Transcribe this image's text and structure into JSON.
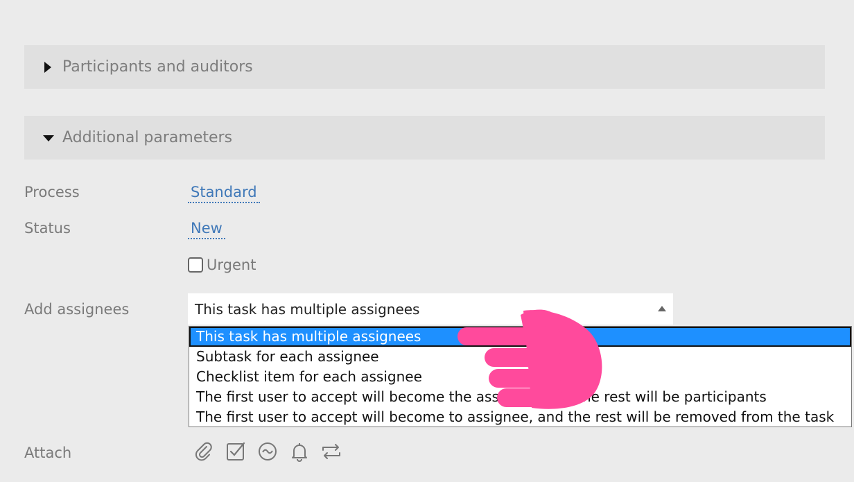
{
  "sections": {
    "participants": {
      "label": "Participants and auditors",
      "expanded": false
    },
    "additional": {
      "label": "Additional parameters",
      "expanded": true
    }
  },
  "fields": {
    "process": {
      "label": "Process",
      "value": "Standard"
    },
    "status": {
      "label": "Status",
      "value": "New"
    },
    "urgent": {
      "label": "Urgent",
      "checked": false
    },
    "assignees": {
      "label": "Add assignees",
      "selected": "This task has multiple assignees",
      "options": [
        "This task has multiple assignees",
        "Subtask for each assignee",
        "Checklist item for each assignee",
        "The first user to accept will become the assignee, and the rest will be participants",
        "The first user to accept will become to assignee, and the rest will be removed from the task"
      ]
    },
    "attach": {
      "label": "Attach",
      "icons": [
        "paperclip-icon",
        "checklist-icon",
        "wave-icon",
        "bell-icon",
        "repeat-icon"
      ]
    }
  },
  "colors": {
    "link": "#3f78b8",
    "highlight": "#1e90ff",
    "hand": "#ff4a9c"
  }
}
